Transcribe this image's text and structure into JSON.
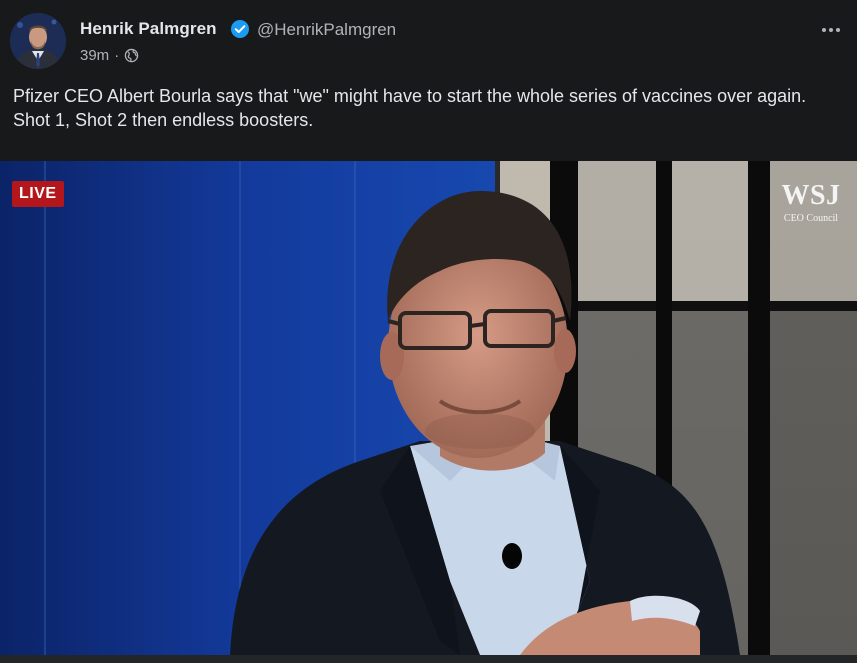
{
  "post": {
    "author_name": "Henrik Palmgren",
    "handle": "@HenrikPalmgren",
    "time": "39m",
    "separator": "·",
    "audience_icon": "globe-icon",
    "text": "Pfizer CEO Albert Bourla says that \"we\" might have to start the whole series of vaccines over again.\nShot 1, Shot 2 then endless boosters."
  },
  "video": {
    "live_label": "LIVE",
    "logo_main": "WSJ",
    "logo_sub": "CEO Council"
  },
  "colors": {
    "background": "#18191a",
    "text_primary": "#e4e6eb",
    "text_secondary": "#b0b3b8",
    "verified_blue": "#1d9bf0",
    "live_red": "#b3171b"
  }
}
